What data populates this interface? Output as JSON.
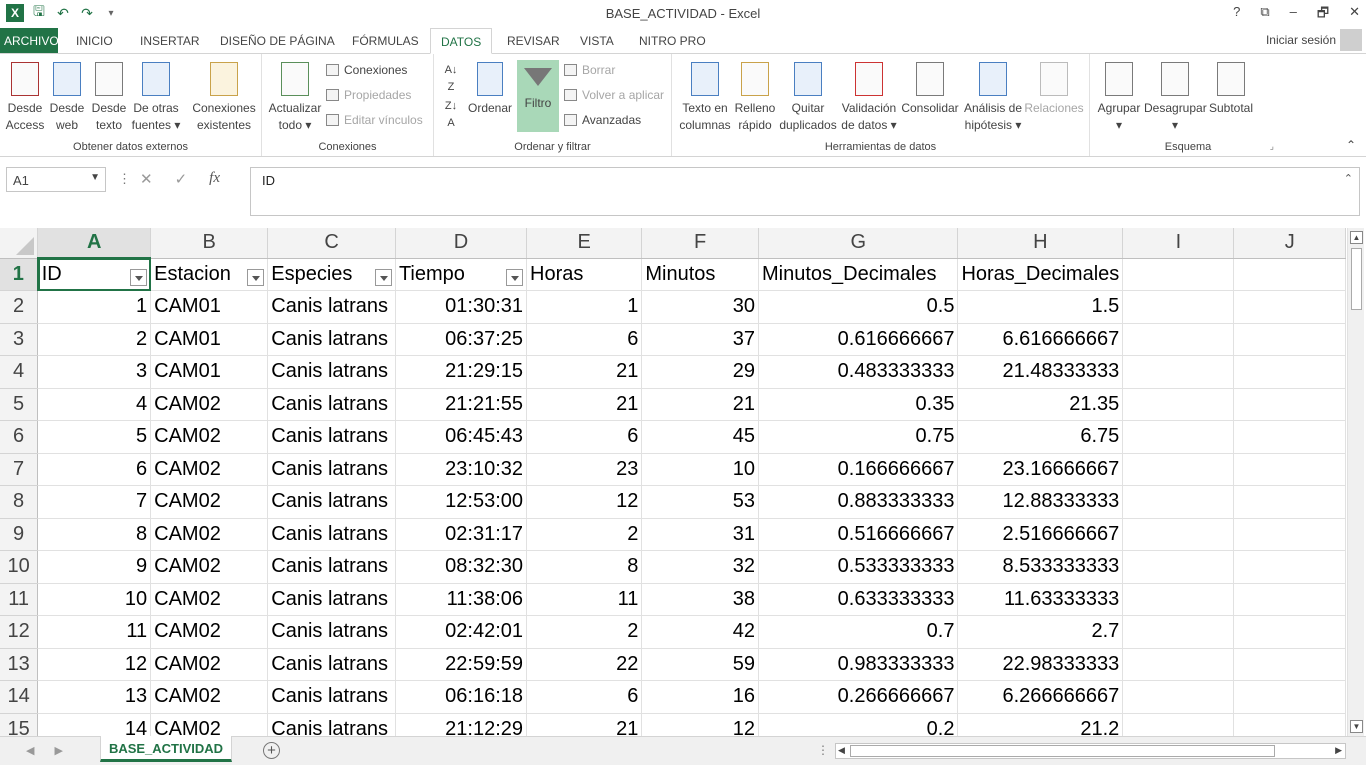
{
  "window": {
    "title": "BASE_ACTIVIDAD - Excel",
    "logo": "X",
    "controls": [
      "?",
      "⧉",
      "–",
      "🗗",
      "✕"
    ]
  },
  "ribbon_tabs": [
    "ARCHIVO",
    "INICIO",
    "INSERTAR",
    "DISEÑO DE PÁGINA",
    "FÓRMULAS",
    "DATOS",
    "REVISAR",
    "VISTA",
    "NITRO PRO"
  ],
  "active_tab": "DATOS",
  "signin": "Iniciar sesión",
  "ribbon": {
    "external_data": {
      "label": "Obtener datos externos",
      "buttons": [
        "Desde\nAccess",
        "Desde\nweb",
        "Desde\ntexto",
        "De otras\nfuentes ▾",
        "Conexiones\nexistentes"
      ]
    },
    "connections": {
      "label": "Conexiones",
      "refresh": "Actualizar\ntodo ▾",
      "items": [
        "Conexiones",
        "Propiedades",
        "Editar vínculos"
      ]
    },
    "sort_filter": {
      "label": "Ordenar y filtrar",
      "sort": "Ordenar",
      "filter": "Filtro",
      "items": [
        "Borrar",
        "Volver a aplicar",
        "Avanzadas"
      ]
    },
    "data_tools": {
      "label": "Herramientas de datos",
      "buttons": [
        "Texto en\ncolumnas",
        "Relleno\nrápido",
        "Quitar\nduplicados",
        "Validación\nde datos ▾",
        "Consolidar",
        "Análisis de\nhipótesis ▾",
        "Relaciones"
      ]
    },
    "outline": {
      "label": "Esquema",
      "buttons": [
        "Agrupar\n▾",
        "Desagrupar\n▾",
        "Subtotal"
      ]
    }
  },
  "formula_bar": {
    "name_box": "A1",
    "content": "ID"
  },
  "columns": [
    "A",
    "B",
    "C",
    "D",
    "E",
    "F",
    "G",
    "H",
    "I",
    "J"
  ],
  "headers": [
    "ID",
    "Estacion",
    "Especies",
    "Tiempo",
    "Horas",
    "Minutos",
    "Minutos_Decimales",
    "Horas_Decimales",
    "",
    ""
  ],
  "rows": [
    [
      "1",
      "CAM01",
      "Canis latrans",
      "01:30:31",
      "1",
      "30",
      "0.5",
      "1.5"
    ],
    [
      "2",
      "CAM01",
      "Canis latrans",
      "06:37:25",
      "6",
      "37",
      "0.616666667",
      "6.616666667"
    ],
    [
      "3",
      "CAM01",
      "Canis latrans",
      "21:29:15",
      "21",
      "29",
      "0.483333333",
      "21.48333333"
    ],
    [
      "4",
      "CAM02",
      "Canis latrans",
      "21:21:55",
      "21",
      "21",
      "0.35",
      "21.35"
    ],
    [
      "5",
      "CAM02",
      "Canis latrans",
      "06:45:43",
      "6",
      "45",
      "0.75",
      "6.75"
    ],
    [
      "6",
      "CAM02",
      "Canis latrans",
      "23:10:32",
      "23",
      "10",
      "0.166666667",
      "23.16666667"
    ],
    [
      "7",
      "CAM02",
      "Canis latrans",
      "12:53:00",
      "12",
      "53",
      "0.883333333",
      "12.88333333"
    ],
    [
      "8",
      "CAM02",
      "Canis latrans",
      "02:31:17",
      "2",
      "31",
      "0.516666667",
      "2.516666667"
    ],
    [
      "9",
      "CAM02",
      "Canis latrans",
      "08:32:30",
      "8",
      "32",
      "0.533333333",
      "8.533333333"
    ],
    [
      "10",
      "CAM02",
      "Canis latrans",
      "11:38:06",
      "11",
      "38",
      "0.633333333",
      "11.63333333"
    ],
    [
      "11",
      "CAM02",
      "Canis latrans",
      "02:42:01",
      "2",
      "42",
      "0.7",
      "2.7"
    ],
    [
      "12",
      "CAM02",
      "Canis latrans",
      "22:59:59",
      "22",
      "59",
      "0.983333333",
      "22.98333333"
    ],
    [
      "13",
      "CAM02",
      "Canis latrans",
      "06:16:18",
      "6",
      "16",
      "0.266666667",
      "6.266666667"
    ],
    [
      "14",
      "CAM02",
      "Canis latrans",
      "21:12:29",
      "21",
      "12",
      "0.2",
      "21.2"
    ]
  ],
  "sheet_tab": "BASE_ACTIVIDAD",
  "add_sheet": "+"
}
